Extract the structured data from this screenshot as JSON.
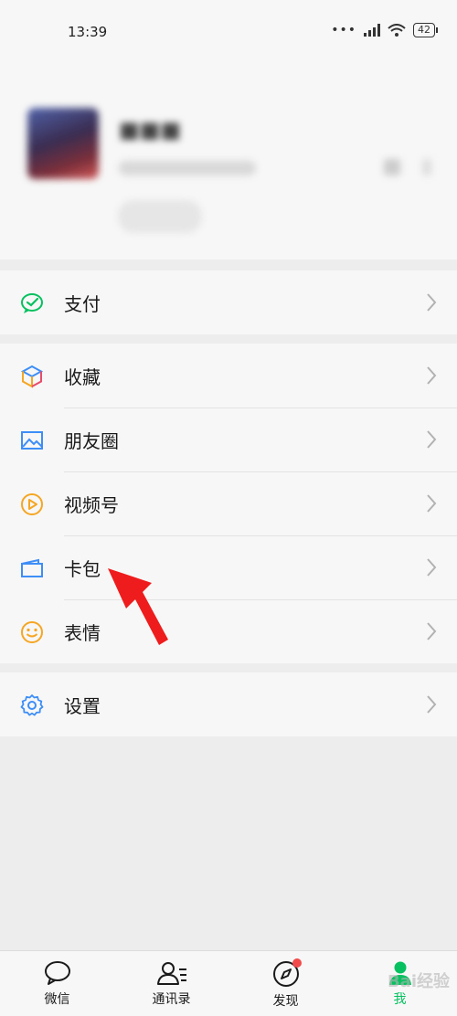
{
  "status_bar": {
    "time": "13:39",
    "battery": "42"
  },
  "menu_groups": [
    [
      {
        "id": "pay",
        "label": "支付",
        "icon": "wechat-pay-icon"
      }
    ],
    [
      {
        "id": "favorites",
        "label": "收藏",
        "icon": "cube-icon"
      },
      {
        "id": "moments",
        "label": "朋友圈",
        "icon": "picture-icon"
      },
      {
        "id": "channels",
        "label": "视频号",
        "icon": "play-circle-icon"
      },
      {
        "id": "cards",
        "label": "卡包",
        "icon": "card-icon"
      },
      {
        "id": "stickers",
        "label": "表情",
        "icon": "smile-icon"
      }
    ],
    [
      {
        "id": "settings",
        "label": "设置",
        "icon": "gear-icon"
      }
    ]
  ],
  "tabs": [
    {
      "label": "微信",
      "icon": "chat-bubble-icon"
    },
    {
      "label": "通讯录",
      "icon": "contacts-icon"
    },
    {
      "label": "发现",
      "icon": "compass-icon",
      "badge_dot": true
    },
    {
      "label": "我",
      "icon": "person-icon",
      "active": true
    }
  ],
  "colors": {
    "accent": "#07c160",
    "annotation_arrow": "#ee1c1c"
  }
}
